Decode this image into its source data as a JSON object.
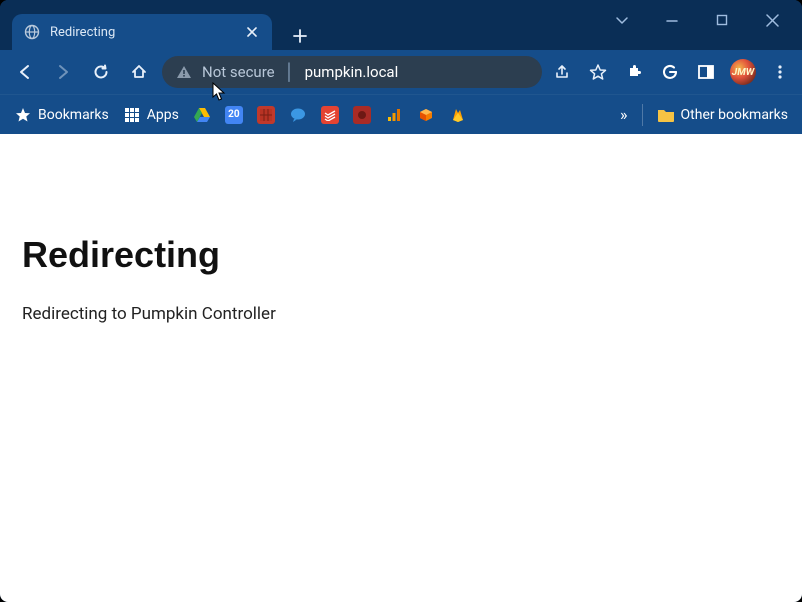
{
  "window": {
    "tab": {
      "title": "Redirecting"
    },
    "address": {
      "security_label": "Not secure",
      "url": "pumpkin.local"
    },
    "avatar_initials": "JMW"
  },
  "bookmarks": {
    "bookmarks_label": "Bookmarks",
    "apps_label": "Apps",
    "other_label": "Other bookmarks",
    "overflow": "»"
  },
  "page": {
    "heading": "Redirecting",
    "body": "Redirecting to Pumpkin Controller"
  }
}
